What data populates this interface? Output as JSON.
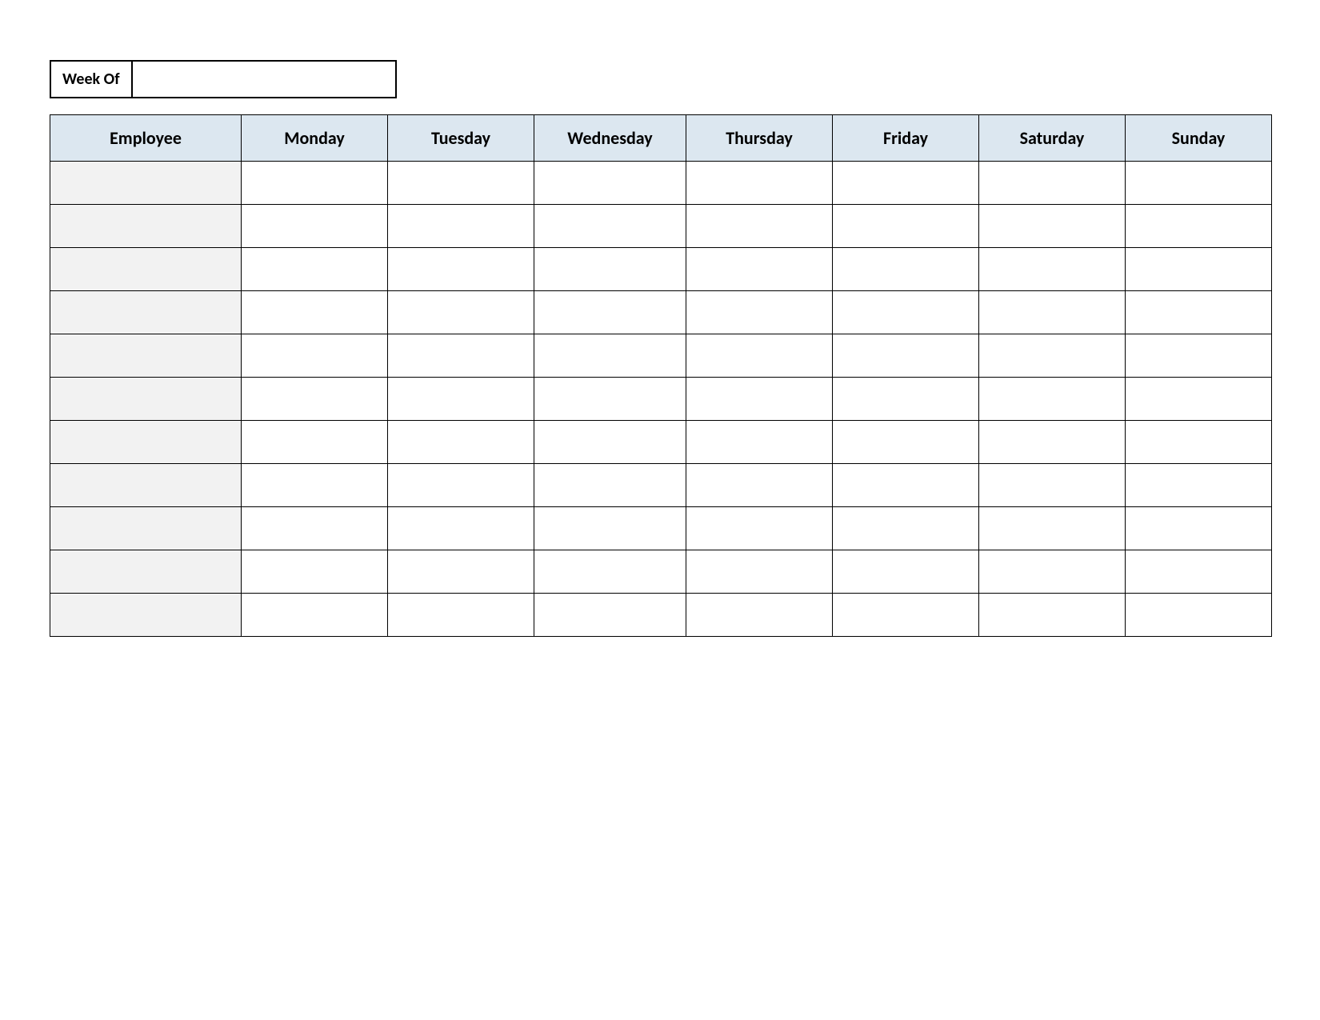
{
  "weekOf": {
    "label": "Week Of",
    "value": ""
  },
  "schedule": {
    "headers": {
      "employee": "Employee",
      "days": [
        "Monday",
        "Tuesday",
        "Wednesday",
        "Thursday",
        "Friday",
        "Saturday",
        "Sunday"
      ]
    },
    "rows": [
      {
        "employee": "",
        "cells": [
          "",
          "",
          "",
          "",
          "",
          "",
          ""
        ]
      },
      {
        "employee": "",
        "cells": [
          "",
          "",
          "",
          "",
          "",
          "",
          ""
        ]
      },
      {
        "employee": "",
        "cells": [
          "",
          "",
          "",
          "",
          "",
          "",
          ""
        ]
      },
      {
        "employee": "",
        "cells": [
          "",
          "",
          "",
          "",
          "",
          "",
          ""
        ]
      },
      {
        "employee": "",
        "cells": [
          "",
          "",
          "",
          "",
          "",
          "",
          ""
        ]
      },
      {
        "employee": "",
        "cells": [
          "",
          "",
          "",
          "",
          "",
          "",
          ""
        ]
      },
      {
        "employee": "",
        "cells": [
          "",
          "",
          "",
          "",
          "",
          "",
          ""
        ]
      },
      {
        "employee": "",
        "cells": [
          "",
          "",
          "",
          "",
          "",
          "",
          ""
        ]
      },
      {
        "employee": "",
        "cells": [
          "",
          "",
          "",
          "",
          "",
          "",
          ""
        ]
      },
      {
        "employee": "",
        "cells": [
          "",
          "",
          "",
          "",
          "",
          "",
          ""
        ]
      },
      {
        "employee": "",
        "cells": [
          "",
          "",
          "",
          "",
          "",
          "",
          ""
        ]
      }
    ]
  }
}
